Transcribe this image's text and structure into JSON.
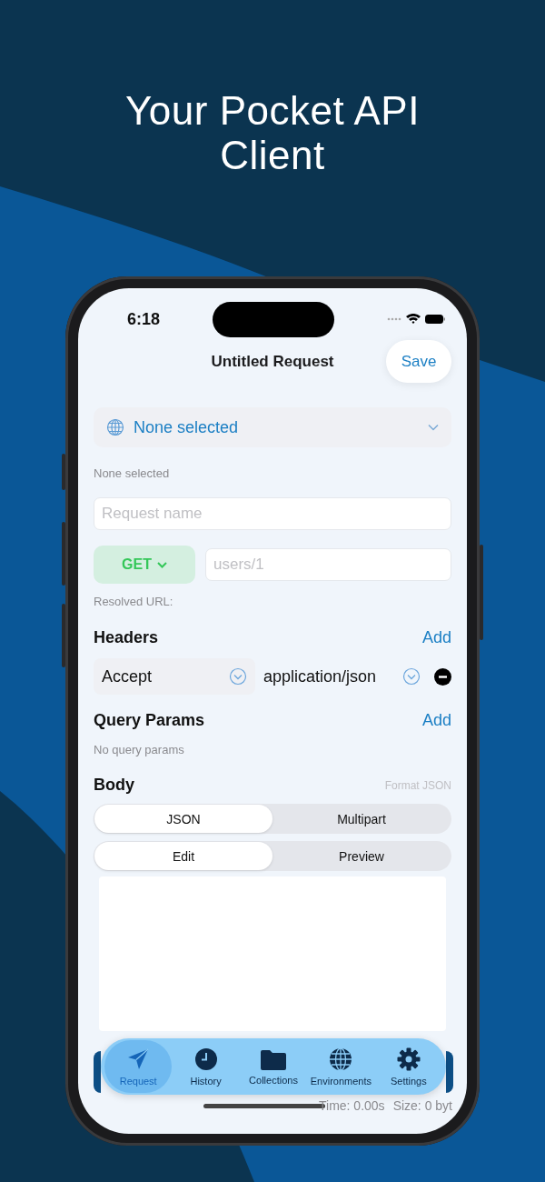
{
  "headline": "Your Pocket API Client",
  "status_bar": {
    "time": "6:18"
  },
  "nav": {
    "title": "Untitled Request",
    "action": "Save"
  },
  "environment": {
    "value": "None selected",
    "caption": "None selected"
  },
  "request_name": {
    "placeholder": "Request name"
  },
  "method": {
    "label": "GET"
  },
  "url": {
    "placeholder": "users/1"
  },
  "resolved_url_label": "Resolved URL:",
  "headers": {
    "title": "Headers",
    "action": "Add",
    "rows": [
      {
        "key": "Accept",
        "value": "application/json"
      }
    ]
  },
  "query_params": {
    "title": "Query Params",
    "action": "Add",
    "empty": "No query params"
  },
  "body": {
    "title": "Body",
    "action": "Format JSON",
    "modes": [
      {
        "label": "JSON",
        "selected": true
      },
      {
        "label": "Multipart",
        "selected": false
      }
    ],
    "views": [
      {
        "label": "Edit",
        "selected": true
      },
      {
        "label": "Preview",
        "selected": false
      }
    ]
  },
  "tab_bar": [
    {
      "label": "Request",
      "kind": "send",
      "selected": true
    },
    {
      "label": "History",
      "kind": "clock",
      "selected": false
    },
    {
      "label": "Collections",
      "kind": "folder",
      "selected": false
    },
    {
      "label": "Environments",
      "kind": "globe",
      "selected": false
    },
    {
      "label": "Settings",
      "kind": "gear",
      "selected": false
    }
  ],
  "footer": {
    "time": "Time: 0.00s",
    "size": "Size: 0 byt"
  }
}
